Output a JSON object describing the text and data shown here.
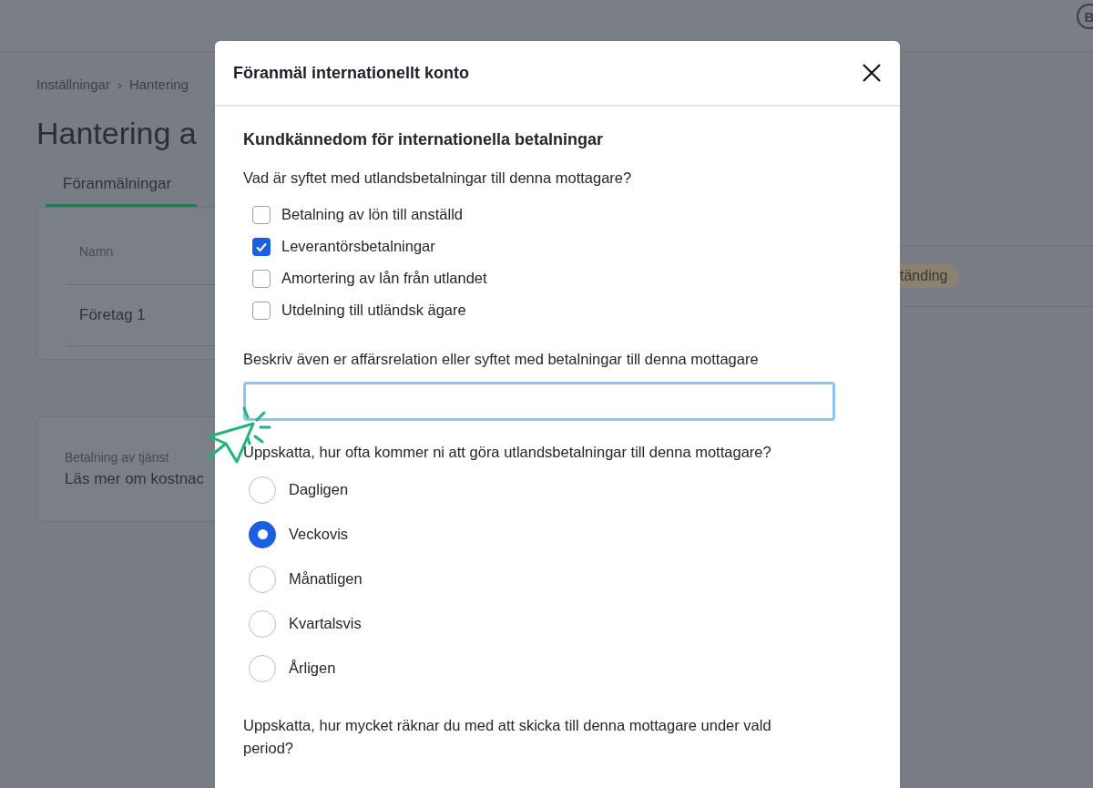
{
  "top_bar": {
    "avatar": "B"
  },
  "breadcrumb": [
    {
      "label": "Inställningar"
    },
    {
      "label": "Hantering"
    }
  ],
  "breadcrumb_separator": "›",
  "page_title": "Hantering a",
  "tabs": [
    {
      "label": "Föranmälningar",
      "selected": true
    }
  ],
  "table": {
    "columns": [
      "Namn"
    ],
    "rows": [
      {
        "name": "Företag 1",
        "status": "tänding"
      }
    ]
  },
  "info_card": {
    "label": "Betalning av tjänst",
    "text": "Läs mer om kostnac"
  },
  "dialog": {
    "title": "Föranmäl internationellt konto",
    "heading": "Kundkännedom för internationella betalningar",
    "purpose_question": "Vad är syftet med utlandsbetalningar till denna mottagare?",
    "purposes": [
      {
        "label": "Betalning av lön till anställd",
        "checked": false
      },
      {
        "label": "Leverantörsbetalningar",
        "checked": true
      },
      {
        "label": "Amortering av lån från utlandet",
        "checked": false
      },
      {
        "label": "Utdelning till utländsk ägare",
        "checked": false
      }
    ],
    "relation_label": "Beskriv även er affärsrelation eller syftet med betalningar till denna mottagare",
    "relation_field": {
      "focused": true
    },
    "frequency_question": "Uppskatta, hur ofta kommer ni att göra utlandsbetalningar till denna mottagare?",
    "frequencies": [
      {
        "label": "Dagligen",
        "selected": false
      },
      {
        "label": "Veckovis",
        "selected": true
      },
      {
        "label": "Månatligen",
        "selected": false
      },
      {
        "label": "Kvartalsvis",
        "selected": false
      },
      {
        "label": "Årligen",
        "selected": false
      }
    ],
    "amount_question": "Uppskatta, hur mycket räknar du med att skicka till denna mottagare under vald period?"
  }
}
